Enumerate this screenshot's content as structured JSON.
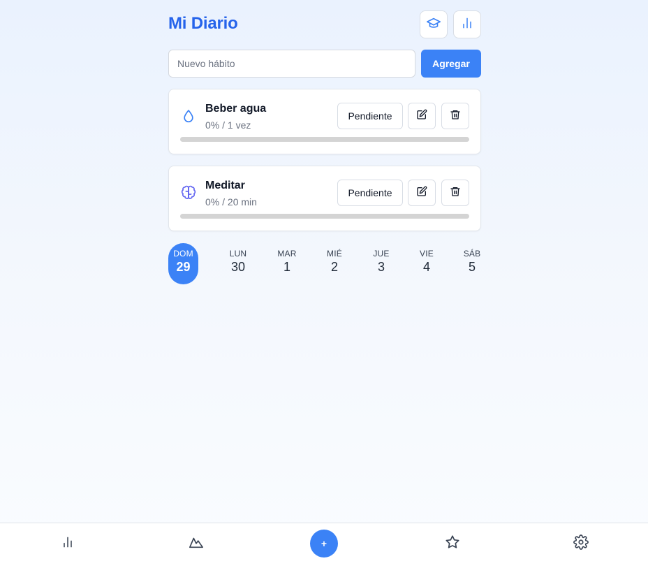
{
  "app": {
    "title": "Mi Diario"
  },
  "header": {
    "buttons": [
      {
        "icon": "graduation-cap-icon"
      },
      {
        "icon": "bar-chart-icon"
      }
    ]
  },
  "add_habit": {
    "placeholder": "Nuevo hábito",
    "value": "",
    "button_label": "Agregar"
  },
  "habits": [
    {
      "name": "Beber agua",
      "progress_text": "0% / 1 vez",
      "progress": 0,
      "status_label": "Pendiente",
      "icon": "water-drop-icon"
    },
    {
      "name": "Meditar",
      "progress_text": "0% / 20 min",
      "progress": 0,
      "status_label": "Pendiente",
      "icon": "brain-icon"
    }
  ],
  "week": [
    {
      "name": "DOM",
      "number": "29",
      "active": true
    },
    {
      "name": "LUN",
      "number": "30",
      "active": false
    },
    {
      "name": "MAR",
      "number": "1",
      "active": false
    },
    {
      "name": "MIÉ",
      "number": "2",
      "active": false
    },
    {
      "name": "JUE",
      "number": "3",
      "active": false
    },
    {
      "name": "VIE",
      "number": "4",
      "active": false
    },
    {
      "name": "SÁB",
      "number": "5",
      "active": false
    }
  ],
  "bottom_nav": {
    "items": [
      {
        "icon": "bar-chart-icon"
      },
      {
        "icon": "mountain-icon"
      },
      {
        "icon": "plus-icon",
        "label": "+"
      },
      {
        "icon": "star-icon"
      },
      {
        "icon": "settings-gear-icon"
      }
    ]
  },
  "colors": {
    "accent": "#3b82f6",
    "title": "#2563eb",
    "brain_icon": "#6366f1"
  }
}
